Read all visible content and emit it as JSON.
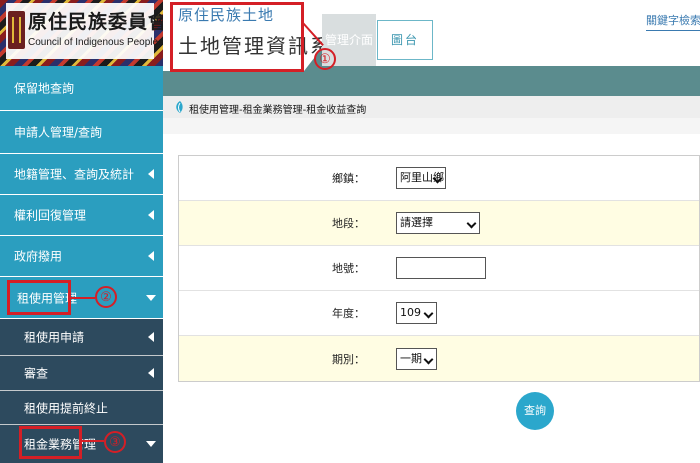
{
  "logo": {
    "title_zh": "原住民族委員會",
    "title_en": "Council of Indigenous Peoples"
  },
  "system": {
    "line1": "原住民族土地",
    "line2": "土地管理資訊系統"
  },
  "tabs": {
    "admin": "管理介面",
    "platform": "圖台"
  },
  "keyword_search": "關鍵字檢索",
  "breadcrumb": "租使用管理-租金業務管理-租金收益查詢",
  "sidebar": {
    "items": [
      {
        "label": "保留地查詢",
        "caret": "none"
      },
      {
        "label": "申請人管理/查詢",
        "caret": "none"
      },
      {
        "label": "地籍管理、查詢及統計",
        "caret": "left"
      },
      {
        "label": "權利回復管理",
        "caret": "left"
      },
      {
        "label": "政府撥用",
        "caret": "left"
      },
      {
        "label": "租使用管理",
        "caret": "down"
      }
    ],
    "subitems": [
      {
        "label": "租使用申請",
        "caret": "left"
      },
      {
        "label": "審查",
        "caret": "left"
      },
      {
        "label": "租使用提前終止",
        "caret": "none"
      },
      {
        "label": "租金業務管理",
        "caret": "down"
      }
    ]
  },
  "form": {
    "township_label": "鄉鎮：",
    "township_value": "阿里山鄉",
    "section_label": "地段：",
    "section_value": "請選擇",
    "landno_label": "地號：",
    "landno_value": "",
    "year_label": "年度：",
    "year_value": "109",
    "period_label": "期別：",
    "period_value": "一期"
  },
  "query_button": "查詢",
  "annotations": {
    "n1": "①",
    "n2": "②",
    "n3": "③"
  },
  "colors": {
    "sidebar": "#2b9ebf",
    "sidebar_sub": "#2d4a5e",
    "header_band": "#5b8c8e",
    "accent": "#2ba7cc",
    "highlight_row": "#fffde3",
    "annotation": "#d41f26"
  }
}
